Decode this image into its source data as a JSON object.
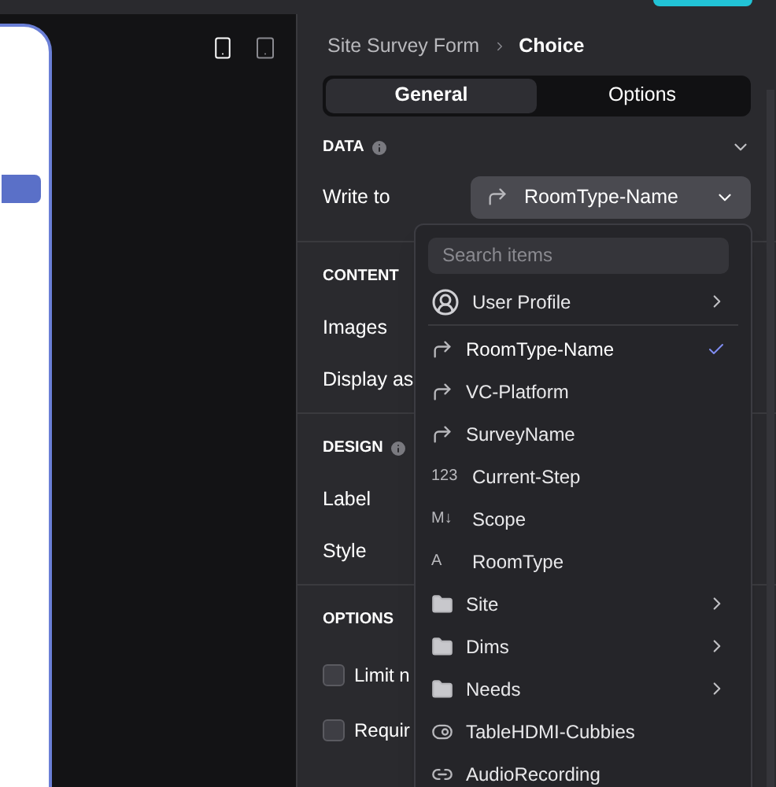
{
  "canvas": {
    "device_buttons": [
      {
        "kind": "phone",
        "selected": true
      },
      {
        "kind": "tablet",
        "selected": false
      }
    ]
  },
  "panel": {
    "breadcrumb": [
      "Site Survey Form",
      "Choice"
    ],
    "tabs": [
      {
        "label": "General",
        "selected": true
      },
      {
        "label": "Options",
        "selected": false
      }
    ],
    "sections": [
      {
        "title": "DATA",
        "info": true,
        "collapsible": true,
        "rows": [
          {
            "label": "Write to",
            "kind": "select"
          }
        ]
      },
      {
        "title": "CONTENT",
        "info": false,
        "collapsible": false,
        "rows": [
          {
            "label": "Images",
            "kind": "plain"
          },
          {
            "label": "Display as",
            "kind": "plain"
          }
        ]
      },
      {
        "title": "DESIGN",
        "info": true,
        "collapsible": false,
        "rows": [
          {
            "label": "Label",
            "kind": "plain"
          },
          {
            "label": "Style",
            "kind": "plain"
          }
        ]
      },
      {
        "title": "OPTIONS",
        "info": false,
        "collapsible": false,
        "rows": [
          {
            "label": "Limit n",
            "kind": "checkbox",
            "checked": false
          },
          {
            "label": "Requir",
            "kind": "checkbox",
            "checked": false
          }
        ]
      }
    ],
    "select": {
      "value": "RoomType-Name"
    }
  },
  "dropdown": {
    "search": {
      "placeholder": "Search items"
    },
    "items": [
      {
        "label": "User Profile",
        "kind": "user",
        "selected": false,
        "has_children": true
      },
      {
        "label": "RoomType-Name",
        "kind": "reference",
        "selected": true,
        "has_children": false
      },
      {
        "label": "VC-Platform",
        "kind": "reference",
        "selected": false,
        "has_children": false
      },
      {
        "label": "SurveyName",
        "kind": "reference",
        "selected": false,
        "has_children": false
      },
      {
        "label": "Current-Step",
        "kind": "glyph",
        "glyph": "123",
        "selected": false,
        "has_children": false
      },
      {
        "label": "Scope",
        "kind": "glyph",
        "glyph": "M↓",
        "selected": false,
        "has_children": false
      },
      {
        "label": "RoomType",
        "kind": "glyph",
        "glyph": "A",
        "selected": false,
        "has_children": false
      },
      {
        "label": "Site",
        "kind": "folder",
        "selected": false,
        "has_children": true
      },
      {
        "label": "Dims",
        "kind": "folder",
        "selected": false,
        "has_children": true
      },
      {
        "label": "Needs",
        "kind": "folder",
        "selected": false,
        "has_children": true
      },
      {
        "label": "TableHDMI-Cubbies",
        "kind": "toggle",
        "selected": false,
        "has_children": false
      },
      {
        "label": "AudioRecording",
        "kind": "link",
        "selected": false,
        "has_children": false
      }
    ]
  }
}
